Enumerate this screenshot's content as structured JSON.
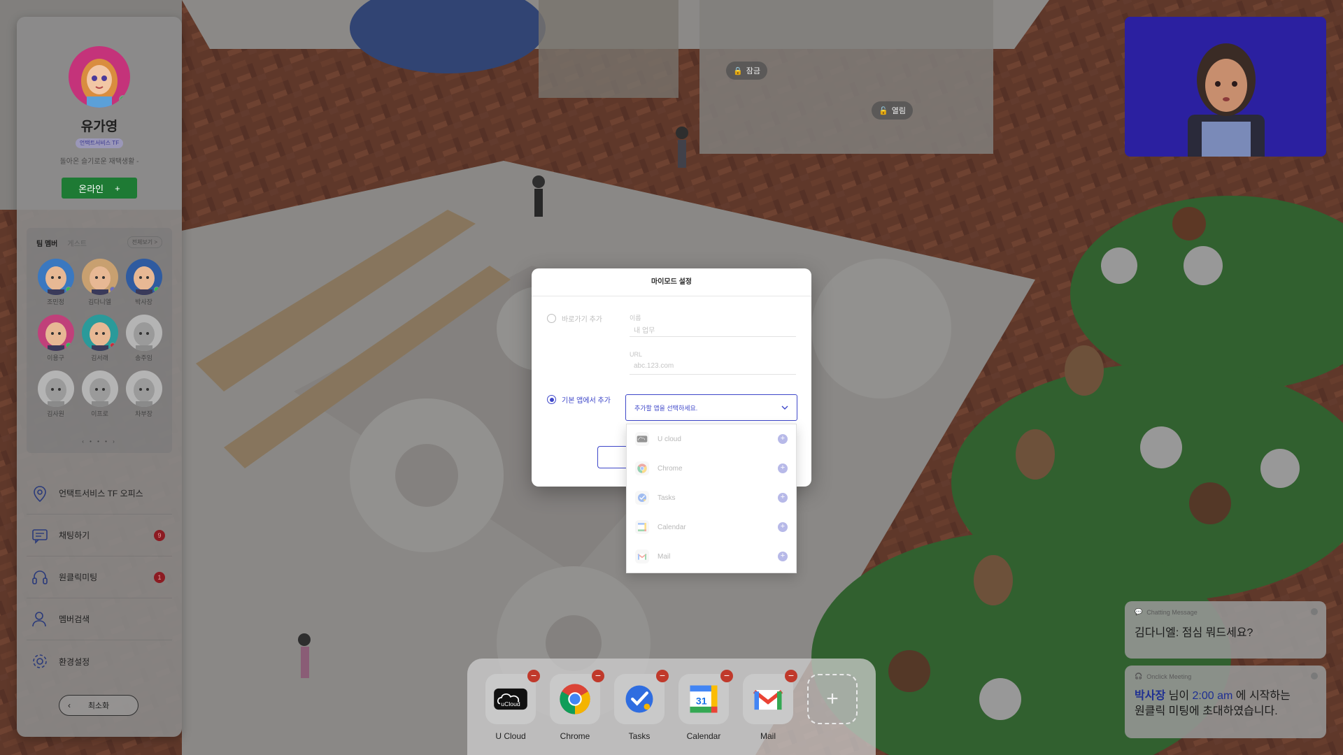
{
  "profile": {
    "name": "유가영",
    "team": "언택트서비스 TF",
    "status_message": "돌아온 슬기로운 재택생활 -",
    "online_label": "온라인",
    "online_plus": "+"
  },
  "members": {
    "tab_team": "팀 멤버",
    "tab_guest": "게스트",
    "see_all": "전체보기 >",
    "list": [
      {
        "name": "조민정",
        "status": "online"
      },
      {
        "name": "김다니엘",
        "status": "away"
      },
      {
        "name": "박사장",
        "status": "online"
      },
      {
        "name": "이용구",
        "status": "online"
      },
      {
        "name": "김서래",
        "status": "busy"
      },
      {
        "name": "송주임",
        "status": "offline"
      },
      {
        "name": "김사원",
        "status": "offline"
      },
      {
        "name": "이프로",
        "status": "offline"
      },
      {
        "name": "차부장",
        "status": "offline"
      }
    ],
    "pager": "‹ • • • ›"
  },
  "menu": [
    {
      "label": "언택트서비스 TF 오피스",
      "icon": "location-pin-icon",
      "badge": ""
    },
    {
      "label": "채팅하기",
      "icon": "chat-icon",
      "badge": "9"
    },
    {
      "label": "원클릭미팅",
      "icon": "headset-icon",
      "badge": "1"
    },
    {
      "label": "멤버검색",
      "icon": "member-search-icon",
      "badge": ""
    },
    {
      "label": "환경설정",
      "icon": "gear-icon",
      "badge": ""
    }
  ],
  "minimize": {
    "chevron": "‹",
    "label": "최소화"
  },
  "room_tags": {
    "locked": "잠금",
    "open": "열림"
  },
  "notifications": {
    "chat": {
      "header": "Chatting Message",
      "body": "김다니엘: 점심 뭐드세요?"
    },
    "meeting": {
      "header": "Onclick Meeting",
      "host": "박사장",
      "text_1": " 님이 ",
      "time": "2:00 am",
      "text_2": " 에 시작하는",
      "line_2": "원클릭 미팅에 초대하였습니다."
    }
  },
  "dock": {
    "apps": [
      {
        "label": "U Cloud",
        "icon": "ucloud-icon",
        "icon_text": "uCloud"
      },
      {
        "label": "Chrome",
        "icon": "chrome-icon"
      },
      {
        "label": "Tasks",
        "icon": "tasks-icon"
      },
      {
        "label": "Calendar",
        "icon": "calendar-icon",
        "icon_text": "31"
      },
      {
        "label": "Mail",
        "icon": "gmail-icon"
      }
    ],
    "remove_symbol": "−",
    "add_symbol": "+"
  },
  "modal": {
    "title": "마이모드 설정",
    "option_shortcut": "바로가기 추가",
    "name_label": "이름",
    "name_placeholder": "내 업무",
    "url_label": "URL",
    "url_placeholder": "abc.123.com",
    "option_default": "기본 앱에서 추가",
    "select_placeholder": "추가할 앱을 선택하세요.",
    "dropdown": [
      {
        "label": "U cloud",
        "icon": "ucloud-icon"
      },
      {
        "label": "Chrome",
        "icon": "chrome-icon"
      },
      {
        "label": "Tasks",
        "icon": "tasks-icon"
      },
      {
        "label": "Calendar",
        "icon": "calendar-icon"
      },
      {
        "label": "Mail",
        "icon": "gmail-icon"
      }
    ],
    "add_symbol": "+"
  },
  "colors": {
    "accent": "#3e47c9",
    "online_green": "#1e7a34",
    "badge_red": "#8c1b22",
    "video_bg": "#2b20a0"
  }
}
